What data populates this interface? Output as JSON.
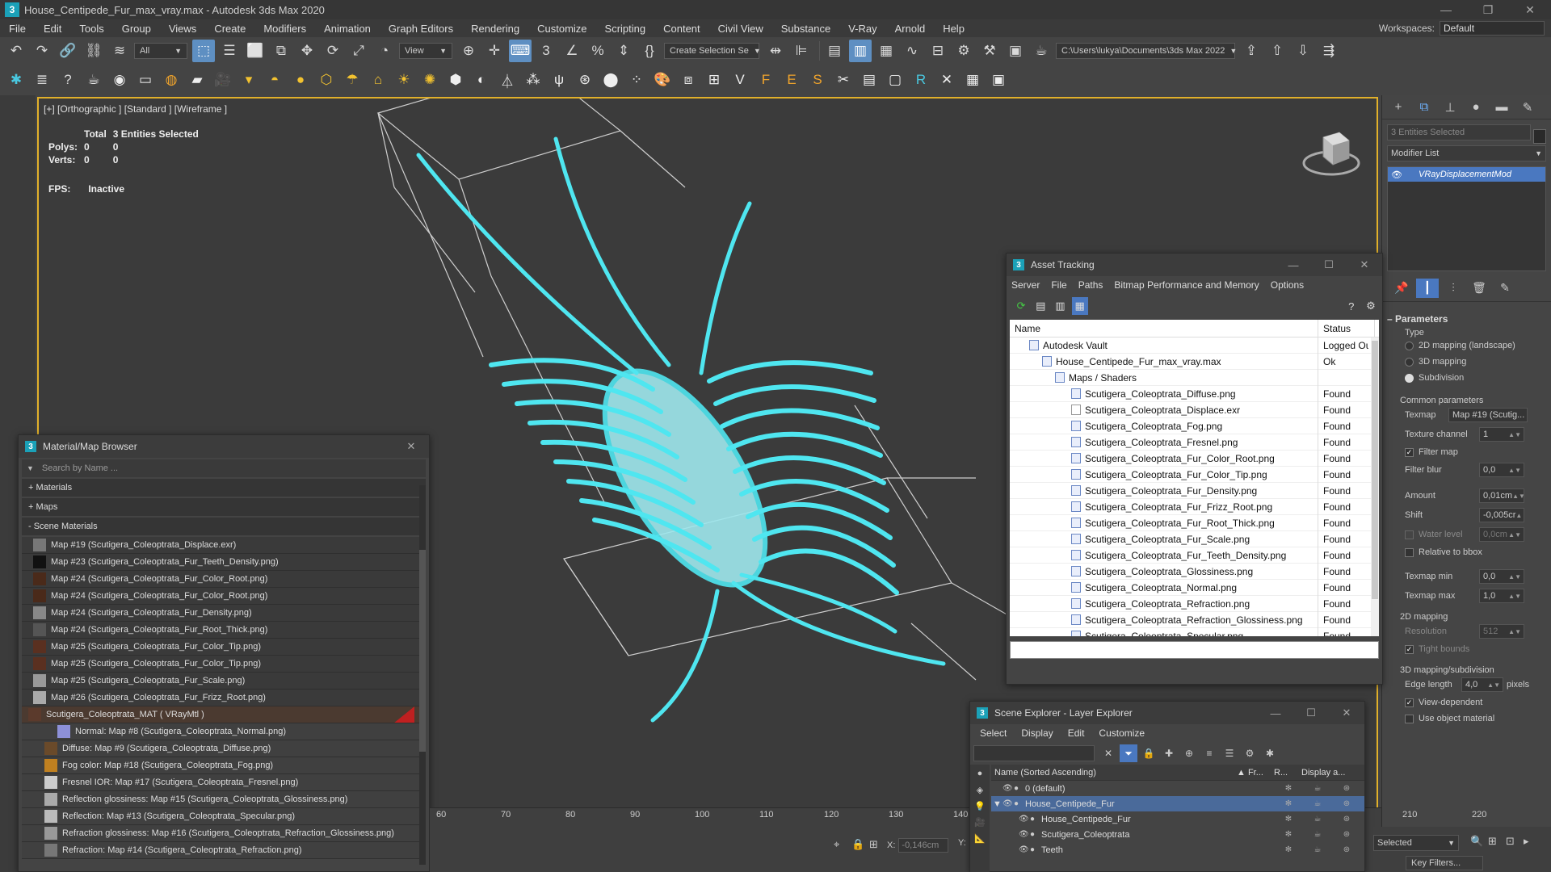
{
  "app": {
    "title": "House_Centipede_Fur_max_vray.max - Autodesk 3ds Max 2020",
    "logo": "3",
    "menus": [
      "File",
      "Edit",
      "Tools",
      "Group",
      "Views",
      "Create",
      "Modifiers",
      "Animation",
      "Graph Editors",
      "Rendering",
      "Customize",
      "Scripting",
      "Content",
      "Civil View",
      "Substance",
      "V-Ray",
      "Arnold",
      "Help"
    ],
    "workspace_label": "Workspaces:",
    "workspace_value": "Default"
  },
  "toolbar": {
    "filter_value": "All",
    "view_value": "View",
    "selection_set_value": "Create Selection Se",
    "project_path": "C:\\Users\\lukya\\Documents\\3ds Max 2022"
  },
  "viewport": {
    "label": "[+] [Orthographic ] [Standard ] [Wireframe ]",
    "stats_total_label": "Total",
    "stats_selected": "3 Entities Selected",
    "polys_label": "Polys:",
    "polys_total": "0",
    "polys_sel": "0",
    "verts_label": "Verts:",
    "verts_total": "0",
    "verts_sel": "0",
    "fps_label": "FPS:",
    "fps_value": "Inactive",
    "wire_color": "#4fe6f0"
  },
  "command_panel": {
    "selection_name": "3 Entities Selected",
    "modifier_list": "Modifier List",
    "modifier": "VRayDisplacementMod",
    "parameters_title": "Parameters",
    "type_label": "Type",
    "type_options": [
      "2D mapping (landscape)",
      "3D mapping",
      "Subdivision"
    ],
    "type_selected": "Subdivision",
    "common_params": "Common parameters",
    "texmap_label": "Texmap",
    "texmap_value": "Map #19 (Scutig...",
    "tex_channel_label": "Texture channel",
    "tex_channel_value": "1",
    "filter_map_label": "Filter map",
    "filter_blur_label": "Filter blur",
    "filter_blur_value": "0,0",
    "amount_label": "Amount",
    "amount_value": "0,01cm",
    "shift_label": "Shift",
    "shift_value": "-0,005cr",
    "water_level_label": "Water level",
    "water_level_value": "0,0cm",
    "relative_bbox_label": "Relative to bbox",
    "texmap_min_label": "Texmap min",
    "texmap_min_value": "0,0",
    "texmap_max_label": "Texmap max",
    "texmap_max_value": "1,0",
    "mapping_2d_title": "2D mapping",
    "resolution_label": "Resolution",
    "resolution_value": "512",
    "tight_bounds_label": "Tight bounds",
    "mapping_3d_title": "3D mapping/subdivision",
    "edge_length_label": "Edge length",
    "edge_length_value": "4,0",
    "pixels_label": "pixels",
    "view_dependent_label": "View-dependent",
    "use_object_material_label": "Use object material"
  },
  "material_browser": {
    "title": "Material/Map Browser",
    "search_placeholder": "Search by Name ...",
    "cat_materials": "+ Materials",
    "cat_maps": "+ Maps",
    "cat_scene": "- Scene Materials",
    "maps": [
      {
        "label": "Map #19 (Scutigera_Coleoptrata_Displace.exr)",
        "swatch": "#777777"
      },
      {
        "label": "Map #23 (Scutigera_Coleoptrata_Fur_Teeth_Density.png)",
        "swatch": "#111111"
      },
      {
        "label": "Map #24 (Scutigera_Coleoptrata_Fur_Color_Root.png)",
        "swatch": "#4a2a1a"
      },
      {
        "label": "Map #24 (Scutigera_Coleoptrata_Fur_Color_Root.png)",
        "swatch": "#4a2a1a"
      },
      {
        "label": "Map #24 (Scutigera_Coleoptrata_Fur_Density.png)",
        "swatch": "#888888"
      },
      {
        "label": "Map #24 (Scutigera_Coleoptrata_Fur_Root_Thick.png)",
        "swatch": "#555555"
      },
      {
        "label": "Map #25 (Scutigera_Coleoptrata_Fur_Color_Tip.png)",
        "swatch": "#5a3020"
      },
      {
        "label": "Map #25 (Scutigera_Coleoptrata_Fur_Color_Tip.png)",
        "swatch": "#5a3020"
      },
      {
        "label": "Map #25 (Scutigera_Coleoptrata_Fur_Scale.png)",
        "swatch": "#999999"
      },
      {
        "label": "Map #26 (Scutigera_Coleoptrata_Fur_Frizz_Root.png)",
        "swatch": "#aaaaaa"
      }
    ],
    "material": "Scutigera_Coleoptrata_MAT ( VRayMtl )",
    "submaps": [
      {
        "label": "Normal: Map #8 (Scutigera_Coleoptrata_Normal.png)",
        "swatch": "#8d90d8"
      },
      {
        "label": "Diffuse: Map #9 (Scutigera_Coleoptrata_Diffuse.png)",
        "swatch": "#6a4a2a"
      },
      {
        "label": "Fog color: Map #18 (Scutigera_Coleoptrata_Fog.png)",
        "swatch": "#c08020"
      },
      {
        "label": "Fresnel IOR: Map #17 (Scutigera_Coleoptrata_Fresnel.png)",
        "swatch": "#cccccc"
      },
      {
        "label": "Reflection glossiness: Map #15 (Scutigera_Coleoptrata_Glossiness.png)",
        "swatch": "#aaaaaa"
      },
      {
        "label": "Reflection: Map #13 (Scutigera_Coleoptrata_Specular.png)",
        "swatch": "#bbbbbb"
      },
      {
        "label": "Refraction glossiness: Map #16 (Scutigera_Coleoptrata_Refraction_Glossiness.png)",
        "swatch": "#999999"
      },
      {
        "label": "Refraction: Map #14 (Scutigera_Coleoptrata_Refraction.png)",
        "swatch": "#777777"
      }
    ]
  },
  "asset_tracking": {
    "title": "Asset Tracking",
    "menus": [
      "Server",
      "File",
      "Paths",
      "Bitmap Performance and Memory",
      "Options"
    ],
    "col_name": "Name",
    "col_status": "Status",
    "vault": {
      "label": "Autodesk Vault",
      "status": "Logged Ou"
    },
    "file": {
      "label": "House_Centipede_Fur_max_vray.max",
      "status": "Ok"
    },
    "group": {
      "label": "Maps / Shaders",
      "status": ""
    },
    "assets": [
      {
        "label": "Scutigera_Coleoptrata_Diffuse.png",
        "status": "Found"
      },
      {
        "label": "Scutigera_Coleoptrata_Displace.exr",
        "status": "Found"
      },
      {
        "label": "Scutigera_Coleoptrata_Fog.png",
        "status": "Found"
      },
      {
        "label": "Scutigera_Coleoptrata_Fresnel.png",
        "status": "Found"
      },
      {
        "label": "Scutigera_Coleoptrata_Fur_Color_Root.png",
        "status": "Found"
      },
      {
        "label": "Scutigera_Coleoptrata_Fur_Color_Tip.png",
        "status": "Found"
      },
      {
        "label": "Scutigera_Coleoptrata_Fur_Density.png",
        "status": "Found"
      },
      {
        "label": "Scutigera_Coleoptrata_Fur_Frizz_Root.png",
        "status": "Found"
      },
      {
        "label": "Scutigera_Coleoptrata_Fur_Root_Thick.png",
        "status": "Found"
      },
      {
        "label": "Scutigera_Coleoptrata_Fur_Scale.png",
        "status": "Found"
      },
      {
        "label": "Scutigera_Coleoptrata_Fur_Teeth_Density.png",
        "status": "Found"
      },
      {
        "label": "Scutigera_Coleoptrata_Glossiness.png",
        "status": "Found"
      },
      {
        "label": "Scutigera_Coleoptrata_Normal.png",
        "status": "Found"
      },
      {
        "label": "Scutigera_Coleoptrata_Refraction.png",
        "status": "Found"
      },
      {
        "label": "Scutigera_Coleoptrata_Refraction_Glossiness.png",
        "status": "Found"
      },
      {
        "label": "Scutigera_Coleoptrata_Specular.png",
        "status": "Found"
      }
    ]
  },
  "scene_explorer": {
    "title": "Scene Explorer - Layer Explorer",
    "menus": [
      "Select",
      "Display",
      "Edit",
      "Customize"
    ],
    "col_name": "Name (Sorted Ascending)",
    "col_fr": "▲ Fr...",
    "col_r": "R...",
    "col_display": "Display a...",
    "rows": [
      {
        "label": "0 (default)",
        "selected": false
      },
      {
        "label": "House_Centipede_Fur",
        "selected": true
      },
      {
        "label": "House_Centipede_Fur",
        "selected": false
      },
      {
        "label": "Scutigera_Coleoptrata",
        "selected": false
      },
      {
        "label": "Teeth",
        "selected": false
      }
    ]
  },
  "timeline": {
    "ticks": [
      "60",
      "70",
      "80",
      "90",
      "100",
      "110",
      "120",
      "130",
      "140"
    ],
    "right_ticks": [
      "210",
      "220"
    ]
  },
  "status": {
    "x_label": "X:",
    "x_value": "-0,146cm",
    "y_label": "Y:",
    "selected_label": "Selected",
    "key_filters": "Key Filters..."
  }
}
